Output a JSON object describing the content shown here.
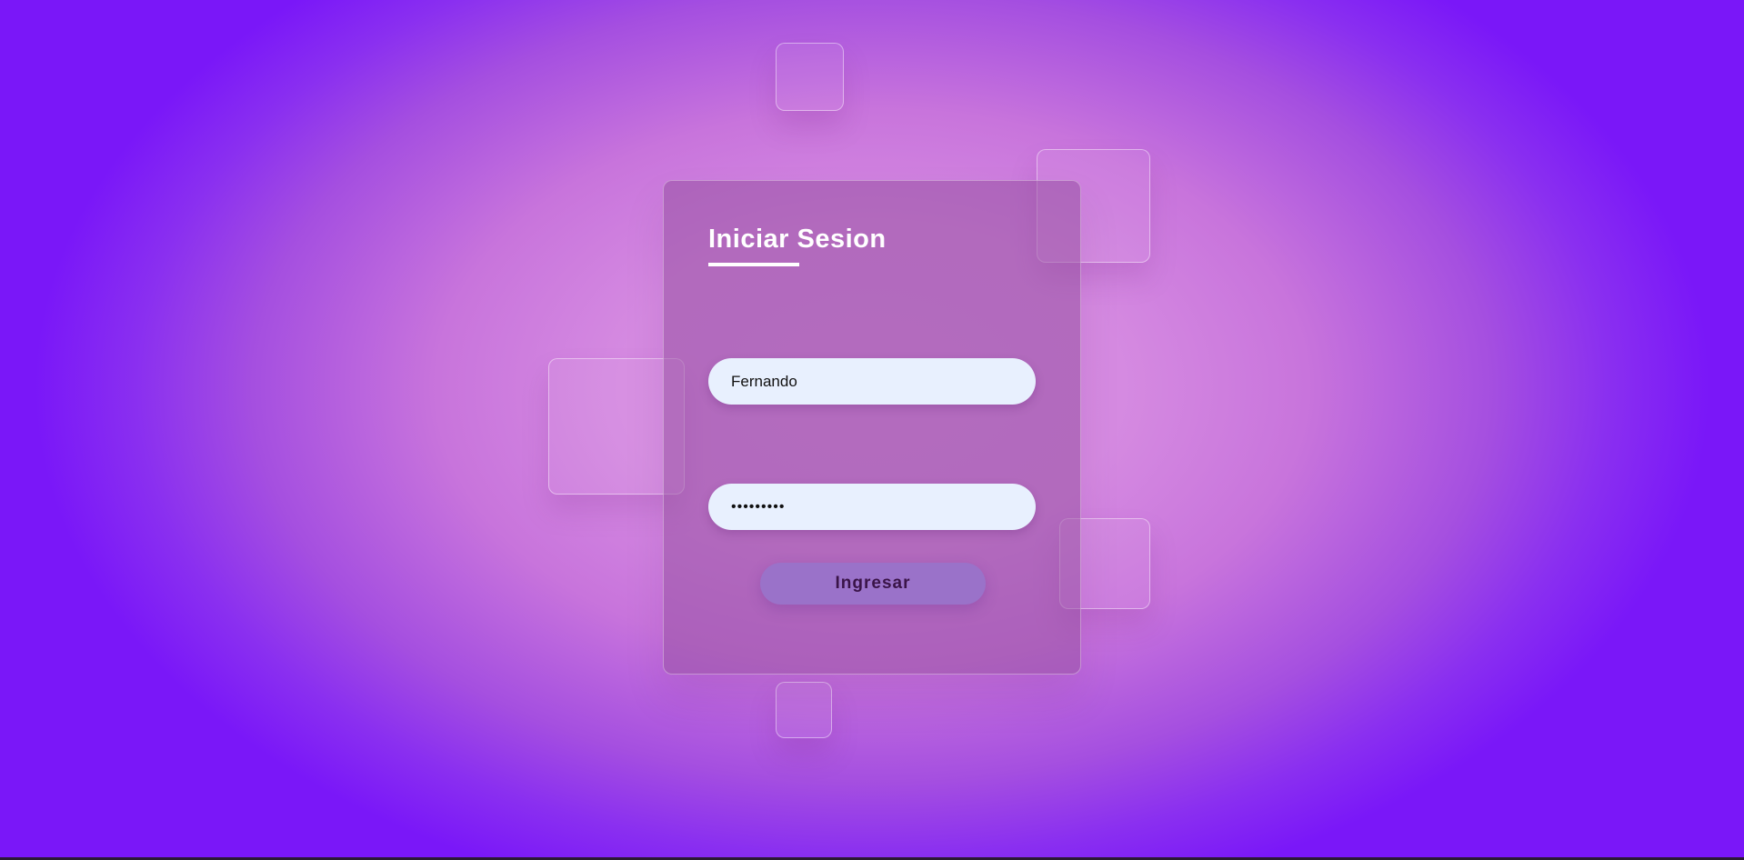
{
  "login": {
    "title": "Iniciar Sesion",
    "username_value": "Fernando",
    "password_value": "•••••••••",
    "submit_label": "Ingresar"
  },
  "colors": {
    "background_center": "#d88ee3",
    "background_edge": "#7a17f8",
    "card": "#a96fb4",
    "input": "#e8f0fe",
    "button": "#9a72c9",
    "button_text": "#3a1448"
  }
}
